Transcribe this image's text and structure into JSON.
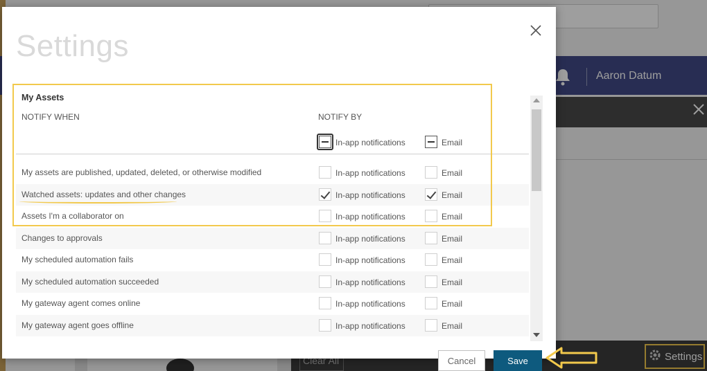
{
  "background": {
    "user_name": "Aaron Datum",
    "clear_all_label": "Clear All",
    "settings_button_label": "Settings"
  },
  "modal": {
    "title": "Settings",
    "section_title": "My Assets",
    "notify_when_header": "NOTIFY WHEN",
    "notify_by_header": "NOTIFY BY",
    "header_inapp_label": "In-app notifications",
    "header_email_label": "Email",
    "rows": [
      {
        "label": "My assets are published, updated, deleted, or otherwise modified",
        "inapp_label": "In-app notifications",
        "email_label": "Email",
        "inapp_checked": false,
        "email_checked": false
      },
      {
        "label": "Watched assets: updates and other changes",
        "inapp_label": "In-app notifications",
        "email_label": "Email",
        "inapp_checked": true,
        "email_checked": true
      },
      {
        "label": "Assets I'm a collaborator on",
        "inapp_label": "In-app notifications",
        "email_label": "Email",
        "inapp_checked": false,
        "email_checked": false
      },
      {
        "label": "Changes to approvals",
        "inapp_label": "In-app notifications",
        "email_label": "Email",
        "inapp_checked": false,
        "email_checked": false
      },
      {
        "label": "My scheduled automation fails",
        "inapp_label": "In-app notifications",
        "email_label": "Email",
        "inapp_checked": false,
        "email_checked": false
      },
      {
        "label": "My scheduled automation succeeded",
        "inapp_label": "In-app notifications",
        "email_label": "Email",
        "inapp_checked": false,
        "email_checked": false
      },
      {
        "label": "My gateway agent comes online",
        "inapp_label": "In-app notifications",
        "email_label": "Email",
        "inapp_checked": false,
        "email_checked": false
      },
      {
        "label": "My gateway agent goes offline",
        "inapp_label": "In-app notifications",
        "email_label": "Email",
        "inapp_checked": false,
        "email_checked": false
      }
    ],
    "cancel_label": "Cancel",
    "save_label": "Save"
  },
  "colors": {
    "topbar": "#414a86",
    "save_button": "#0e5a7e",
    "annotation_yellow": "#f2c94c"
  },
  "icons": [
    "bell-icon",
    "close-icon",
    "gear-icon",
    "arrow-left-icon"
  ]
}
